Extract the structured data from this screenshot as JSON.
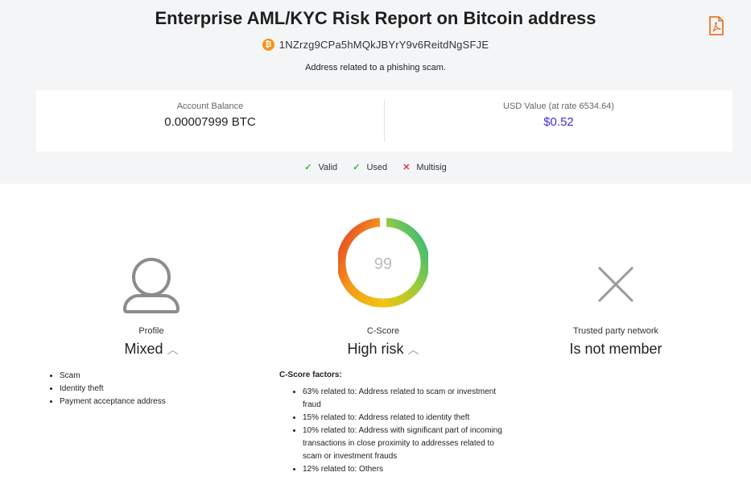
{
  "header": {
    "title": "Enterprise AML/KYC Risk Report on Bitcoin address",
    "address": "1NZrzg9CPa5hMQkJBYrY9v6ReitdNgSFJE",
    "note": "Address related to a phishing scam.",
    "pdf_icon": "pdf-file-icon",
    "btc_glyph": "₿"
  },
  "balance": {
    "account_label": "Account Balance",
    "account_value": "0.00007999 BTC",
    "usd_label": "USD Value (at rate 6534.64)",
    "usd_value": "$0.52"
  },
  "flags": [
    {
      "label": "Valid",
      "state": "ok"
    },
    {
      "label": "Used",
      "state": "ok"
    },
    {
      "label": "Multisig",
      "state": "no"
    }
  ],
  "profile": {
    "caption": "Profile",
    "value": "Mixed",
    "items": [
      "Scam",
      "Identity theft",
      "Payment acceptance address"
    ]
  },
  "cscore": {
    "caption": "C-Score",
    "value": "High risk",
    "score": "99",
    "factors_title": "C-Score factors:",
    "factors": [
      "63% related to: Address related to scam or investment fraud",
      "15% related to: Address related to identity theft",
      "10% related to: Address with significant part of incoming transactions in close proximity to addresses related to scam or investment frauds",
      "12% related to: Others"
    ]
  },
  "trusted": {
    "caption": "Trusted party network",
    "value": "Is not member"
  },
  "colors": {
    "usd": "#3b33d6",
    "btc": "#f7931a",
    "ok": "#36b24a",
    "bad": "#e23b3b",
    "pdf": "#e8772e"
  }
}
